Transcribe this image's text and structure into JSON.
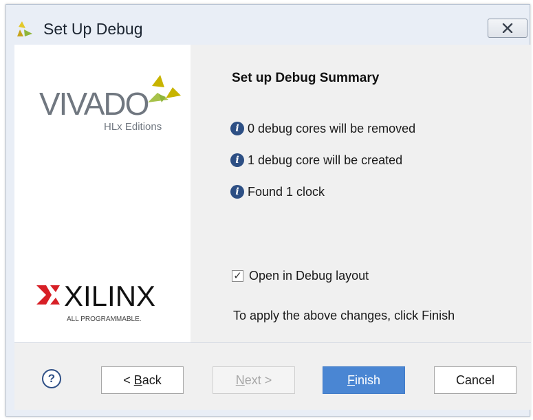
{
  "window": {
    "title": "Set Up Debug",
    "title_icon": "vivado-leaf-icon",
    "close_icon": "close-icon"
  },
  "branding": {
    "vivado_text": "VIVADO",
    "vivado_subtitle": "HLx Editions",
    "xilinx_text": "XILINX",
    "xilinx_tagline": "ALL PROGRAMMABLE."
  },
  "summary": {
    "title": "Set up Debug Summary",
    "items": [
      {
        "icon": "info-icon",
        "text": "0 debug cores will be removed"
      },
      {
        "icon": "info-icon",
        "text": "1 debug core will be created"
      },
      {
        "icon": "info-icon",
        "text": "Found 1 clock"
      }
    ],
    "checkbox": {
      "label": "Open in Debug layout",
      "checked": true
    },
    "apply_text": "To apply the above changes, click Finish"
  },
  "footer": {
    "help_label": "?",
    "back_prefix": "< ",
    "back_mnemonic": "B",
    "back_rest": "ack",
    "next_mnemonic": "N",
    "next_rest": "ext >",
    "finish_mnemonic": "F",
    "finish_rest": "inish",
    "cancel_label": "Cancel"
  },
  "colors": {
    "accent": "#4a86d3",
    "info_icon": "#2d4f84",
    "xilinx_red": "#d71f26",
    "vivado_gold": "#c8b400"
  }
}
